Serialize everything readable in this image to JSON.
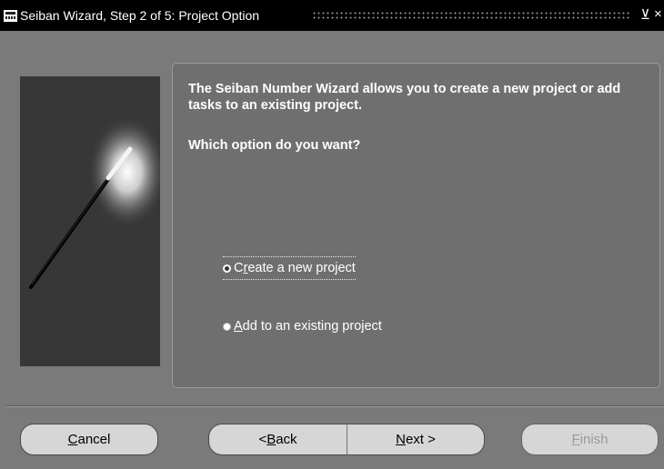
{
  "window": {
    "title": "Seiban Wizard, Step 2 of 5: Project Option",
    "minimize_glyph": "⊻",
    "close_glyph": "×"
  },
  "content": {
    "intro": "The Seiban Number Wizard allows you to create a new project or add tasks to an existing project.",
    "question": "Which option do you want?"
  },
  "options": [
    {
      "mnemonic": "r",
      "label_before": "C",
      "label_after": "eate a new project",
      "selected": true
    },
    {
      "mnemonic": "A",
      "label_before": "",
      "label_after": "dd to an existing project",
      "selected": false
    }
  ],
  "buttons": {
    "cancel": {
      "before": "",
      "mnemonic": "C",
      "after": "ancel",
      "enabled": true
    },
    "back": {
      "before": "< ",
      "mnemonic": "B",
      "after": "ack",
      "enabled": true
    },
    "next": {
      "before": "",
      "mnemonic": "N",
      "after": "ext >",
      "enabled": true
    },
    "finish": {
      "before": "",
      "mnemonic": "F",
      "after": "inish",
      "enabled": false
    }
  },
  "icons": {
    "wand": "magic-wand-icon",
    "app": "app-icon"
  },
  "colors": {
    "background": "#7a7a7a",
    "titlebar": "#000000",
    "graphic_panel": "#373737",
    "button_face": "#d6d6d6"
  }
}
